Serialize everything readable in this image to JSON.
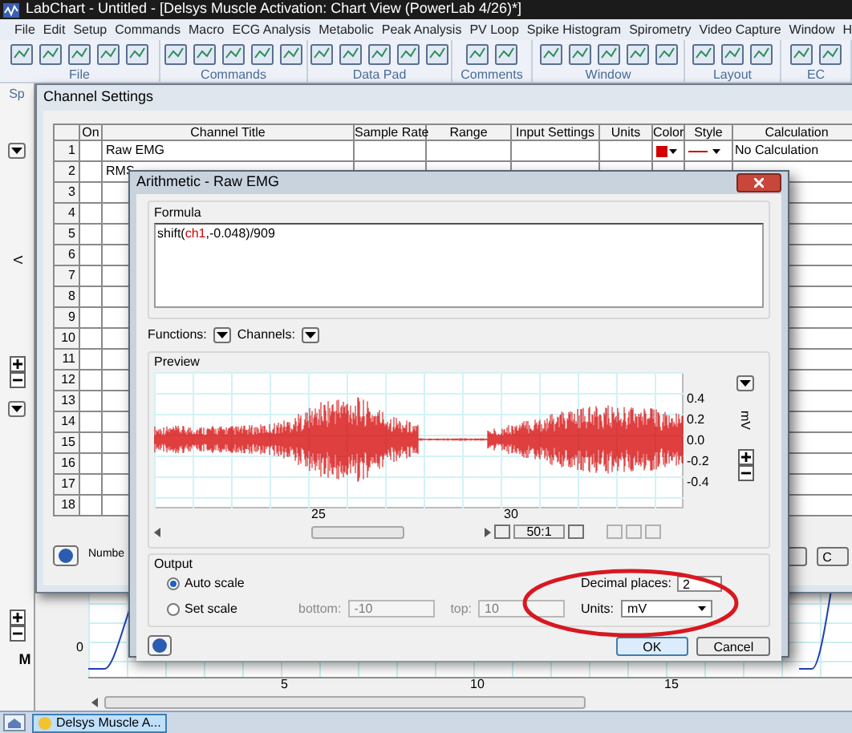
{
  "window": {
    "title": "LabChart - Untitled - [Delsys Muscle Activation: Chart View (PowerLab 4/26)*]"
  },
  "menu": [
    "File",
    "Edit",
    "Setup",
    "Commands",
    "Macro",
    "ECG Analysis",
    "Metabolic",
    "Peak Analysis",
    "PV Loop",
    "Spike Histogram",
    "Spirometry",
    "Video Capture",
    "Window",
    "H"
  ],
  "toolbar_groups": [
    "File",
    "Commands",
    "Data Pad",
    "Comments",
    "Window",
    "Layout",
    "EC"
  ],
  "side_panel": {
    "tab": "Sp",
    "unit": "V"
  },
  "chart_view": {
    "y_tick": "0",
    "x_ticks": [
      "5",
      "10",
      "15"
    ],
    "marker": "M"
  },
  "taskbar": {
    "item": "Delsys Muscle A..."
  },
  "channel_settings": {
    "title": "Channel Settings",
    "columns": [
      "On",
      "Channel Title",
      "Sample Rate",
      "Range",
      "Input Settings",
      "Units",
      "Color",
      "Style",
      "Calculation"
    ],
    "rows": [
      {
        "number": "1",
        "title": "Raw EMG",
        "color": "#d40000",
        "calculation": "No Calculation"
      },
      {
        "number": "2",
        "title": "RMS"
      },
      {
        "number": "3"
      },
      {
        "number": "4"
      },
      {
        "number": "5"
      },
      {
        "number": "6"
      },
      {
        "number": "7"
      },
      {
        "number": "8"
      },
      {
        "number": "9"
      },
      {
        "number": "10"
      },
      {
        "number": "11"
      },
      {
        "number": "12"
      },
      {
        "number": "13"
      },
      {
        "number": "14"
      },
      {
        "number": "15"
      },
      {
        "number": "16"
      },
      {
        "number": "17"
      },
      {
        "number": "18"
      }
    ],
    "footer_label": "Numbe",
    "partial_button": "C"
  },
  "arithmetic": {
    "title": "Arithmetic - Raw EMG",
    "formula_label": "Formula",
    "formula": [
      {
        "kind": "plain",
        "text": "shift("
      },
      {
        "kind": "channel",
        "text": "ch1"
      },
      {
        "kind": "plain",
        "text": ",-0.048)/909"
      }
    ],
    "functions_label": "Functions:",
    "channels_label": "Channels:",
    "preview_label": "Preview",
    "y_ticks": [
      "0.4",
      "0.2",
      "0.0",
      "-0.2",
      "-0.4"
    ],
    "x_ticks": [
      "25",
      "30"
    ],
    "y_unit": "mV",
    "ratio": "50:1",
    "output_label": "Output",
    "scale_options": [
      {
        "label": "Auto scale",
        "selected": true
      },
      {
        "label": "Set scale",
        "selected": false
      }
    ],
    "bottom": {
      "label": "bottom:",
      "value": "-10",
      "disabled": true
    },
    "top": {
      "label": "top:",
      "value": "10",
      "disabled": true
    },
    "decimal_places": {
      "label": "Decimal places:",
      "value": "2"
    },
    "units": {
      "label": "Units:",
      "value": "mV"
    },
    "buttons": [
      "OK",
      "Cancel"
    ]
  }
}
